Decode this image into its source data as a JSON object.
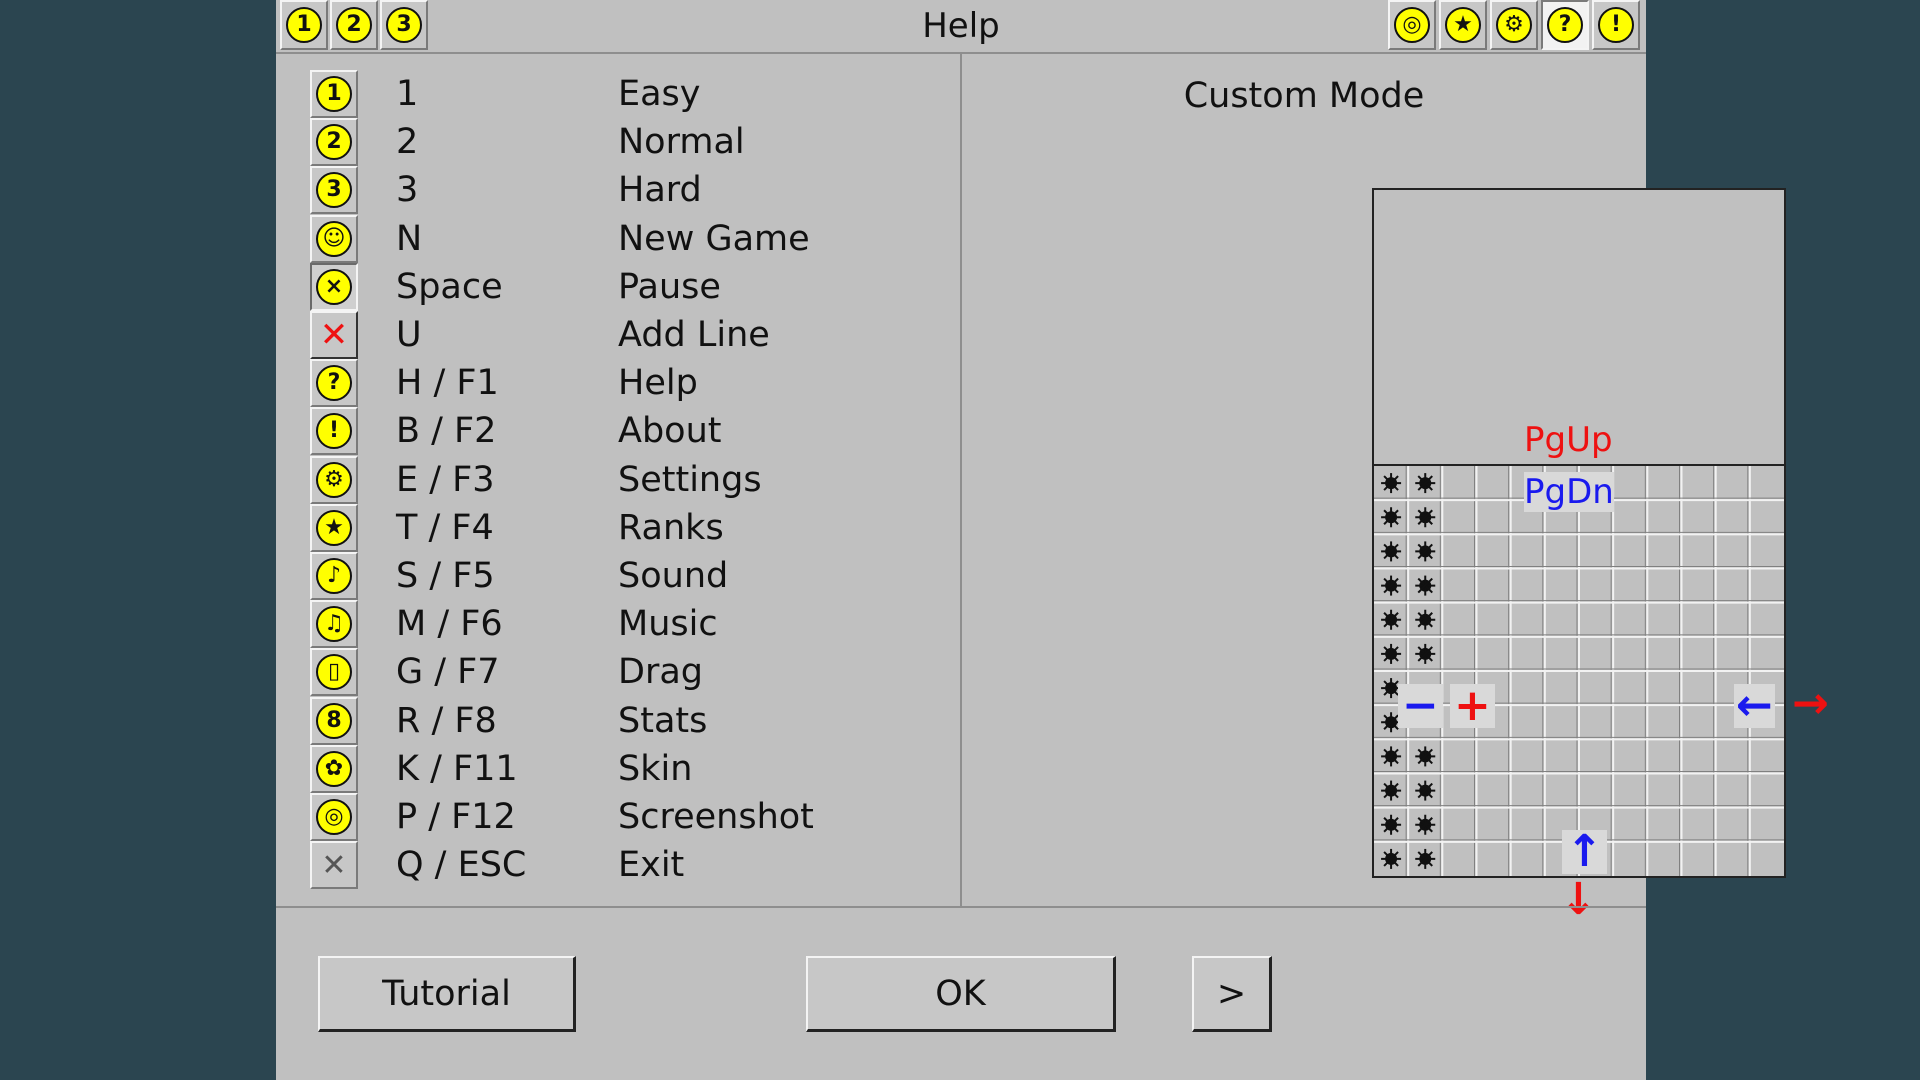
{
  "window": {
    "title": "Help"
  },
  "toolbar_left": [
    {
      "name": "easy-level-icon",
      "glyph": "1"
    },
    {
      "name": "normal-level-icon",
      "glyph": "2"
    },
    {
      "name": "hard-level-icon",
      "glyph": "3"
    }
  ],
  "toolbar_right": [
    {
      "name": "camera-icon",
      "glyph": "◎"
    },
    {
      "name": "star-icon",
      "glyph": "★"
    },
    {
      "name": "gear-icon",
      "glyph": "⚙"
    },
    {
      "name": "help-icon",
      "glyph": "?"
    },
    {
      "name": "exclamation-icon",
      "glyph": "!"
    }
  ],
  "shortcuts": [
    {
      "icon": "digit-1-icon",
      "glyph": "1",
      "key": "1",
      "action": "Easy"
    },
    {
      "icon": "digit-2-icon",
      "glyph": "2",
      "key": "2",
      "action": "Normal"
    },
    {
      "icon": "digit-3-icon",
      "glyph": "3",
      "key": "3",
      "action": "Hard"
    },
    {
      "icon": "smiley-icon",
      "glyph": "☺",
      "key": "N",
      "action": "New Game"
    },
    {
      "icon": "dizzy-face-icon",
      "glyph": "×",
      "key": "Space",
      "action": "Pause"
    },
    {
      "icon": "red-x-icon",
      "glyph": "✕",
      "key": "U",
      "action": "Add Line"
    },
    {
      "icon": "question-icon",
      "glyph": "?",
      "key": "H / F1",
      "action": "Help"
    },
    {
      "icon": "exclamation-icon",
      "glyph": "!",
      "key": "B / F2",
      "action": "About"
    },
    {
      "icon": "gear-icon",
      "glyph": "⚙",
      "key": "E / F3",
      "action": "Settings"
    },
    {
      "icon": "star-icon",
      "glyph": "★",
      "key": "T / F4",
      "action": "Ranks"
    },
    {
      "icon": "speaker-icon",
      "glyph": "♪",
      "key": "S / F5",
      "action": "Sound"
    },
    {
      "icon": "music-note-icon",
      "glyph": "♫",
      "key": "M / F6",
      "action": "Music"
    },
    {
      "icon": "mouse-icon",
      "glyph": "▯",
      "key": "G / F7",
      "action": "Drag"
    },
    {
      "icon": "stats-counter-icon",
      "glyph": "8",
      "key": "R / F8",
      "action": "Stats"
    },
    {
      "icon": "palette-icon",
      "glyph": "✿",
      "key": "K / F11",
      "action": "Skin"
    },
    {
      "icon": "camera-icon",
      "glyph": "◎",
      "key": "P / F12",
      "action": "Screenshot"
    },
    {
      "icon": "close-icon",
      "glyph": "✕",
      "key": "Q / ESC",
      "action": "Exit"
    }
  ],
  "custom_mode": {
    "title": "Custom Mode",
    "pgup": "PgUp",
    "pgdn": "PgDn",
    "minus": "−",
    "plus": "+",
    "left_arrow": "←",
    "right_arrow": "→",
    "up_arrow": "↑",
    "down_arrow": "↓",
    "colors": {
      "red": "#ee1111",
      "blue": "#1a1aee"
    }
  },
  "buttons": {
    "tutorial": "Tutorial",
    "ok": "OK",
    "next": ">"
  }
}
